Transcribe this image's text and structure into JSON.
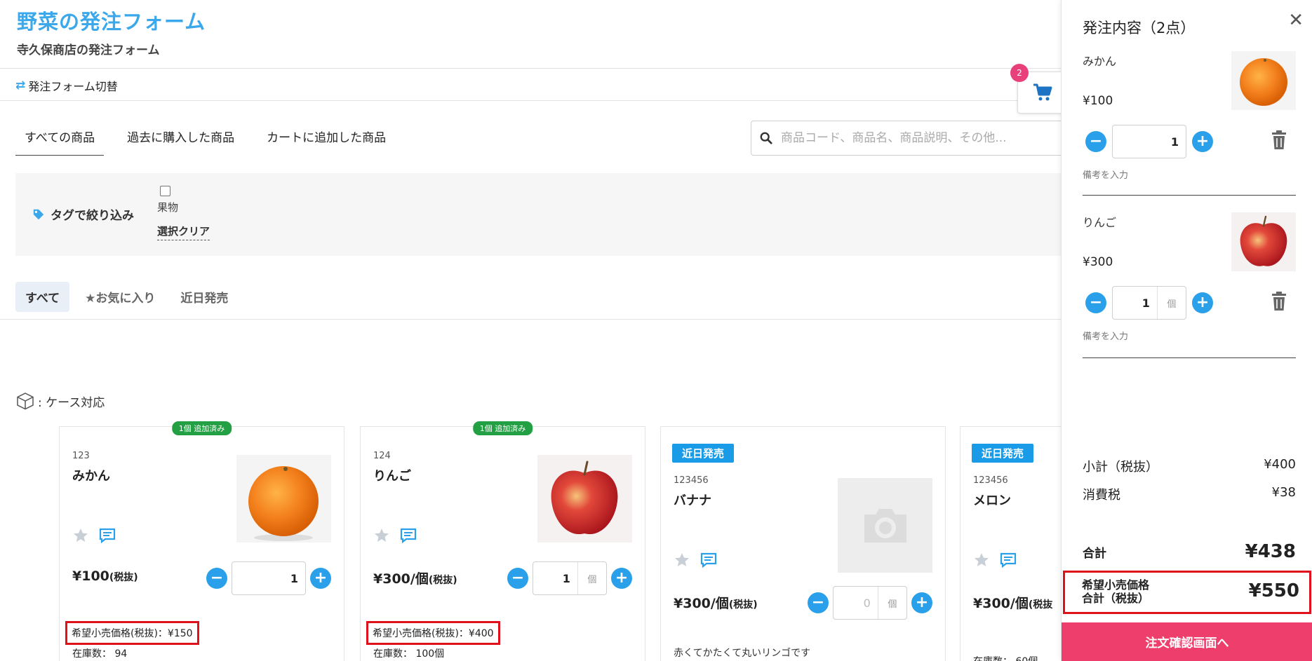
{
  "header": {
    "title": "野菜の発注フォーム",
    "subtitle": "寺久保商店の発注フォーム",
    "switch_label": "発注フォーム切替"
  },
  "cart": {
    "badge_count": "2"
  },
  "tabs": [
    {
      "label": "すべての商品",
      "active": true
    },
    {
      "label": "過去に購入した商品",
      "active": false
    },
    {
      "label": "カートに追加した商品",
      "active": false
    }
  ],
  "search": {
    "placeholder": "商品コード、商品名、商品説明、その他..."
  },
  "filter": {
    "label": "タグで絞り込み",
    "tag": "果物",
    "clear": "選択クリア"
  },
  "subtabs": [
    {
      "label": "すべて",
      "active": true
    },
    {
      "label": "★お気に入り",
      "active": false
    },
    {
      "label": "近日発売",
      "active": false
    }
  ],
  "case_note": ": ケース対応",
  "products": [
    {
      "badge": "1個 追加済み",
      "code": "123",
      "name": "みかん",
      "price": "¥100",
      "tax_label": "(税抜)",
      "qty": "1",
      "retail": "希望小売価格(税抜)：¥150",
      "stock": "在庫数： 94"
    },
    {
      "badge": "1個 追加済み",
      "code": "124",
      "name": "りんご",
      "price": "¥300/個",
      "tax_label": "(税抜)",
      "qty": "1",
      "unit": "個",
      "retail": "希望小売価格(税抜)：¥400",
      "stock": "在庫数： 100個"
    },
    {
      "badge": "近日発売",
      "code": "123456",
      "name": "バナナ",
      "price": "¥300/個",
      "tax_label": "(税抜)",
      "qty": "0",
      "unit": "個",
      "description": "赤くてかたくて丸いリンゴです"
    },
    {
      "badge": "近日発売",
      "code": "123456",
      "name": "メロン",
      "price": "¥300/個",
      "tax_label": "(税抜",
      "stock": "在庫数： 60個"
    }
  ],
  "sidebar": {
    "title": "発注内容（2点）",
    "items": [
      {
        "name": "みかん",
        "price": "¥100",
        "qty": "1",
        "memo": "備考を入力"
      },
      {
        "name": "りんご",
        "price": "¥300",
        "qty": "1",
        "unit": "個",
        "memo": "備考を入力"
      }
    ],
    "subtotal_label": "小計（税抜）",
    "subtotal": "¥400",
    "tax_label": "消費税",
    "tax": "¥38",
    "total_label": "合計",
    "total": "¥438",
    "retail_total_label_1": "希望小売価格",
    "retail_total_label_2": "合計（税抜）",
    "retail_total": "¥550",
    "order_button": "注文確認画面へ"
  },
  "colors": {
    "accent": "#3aa8ea",
    "button_blue": "#2aa0ea",
    "added_green": "#22a043",
    "order_pink": "#ee3f6c",
    "highlight_red": "#e0111b"
  }
}
